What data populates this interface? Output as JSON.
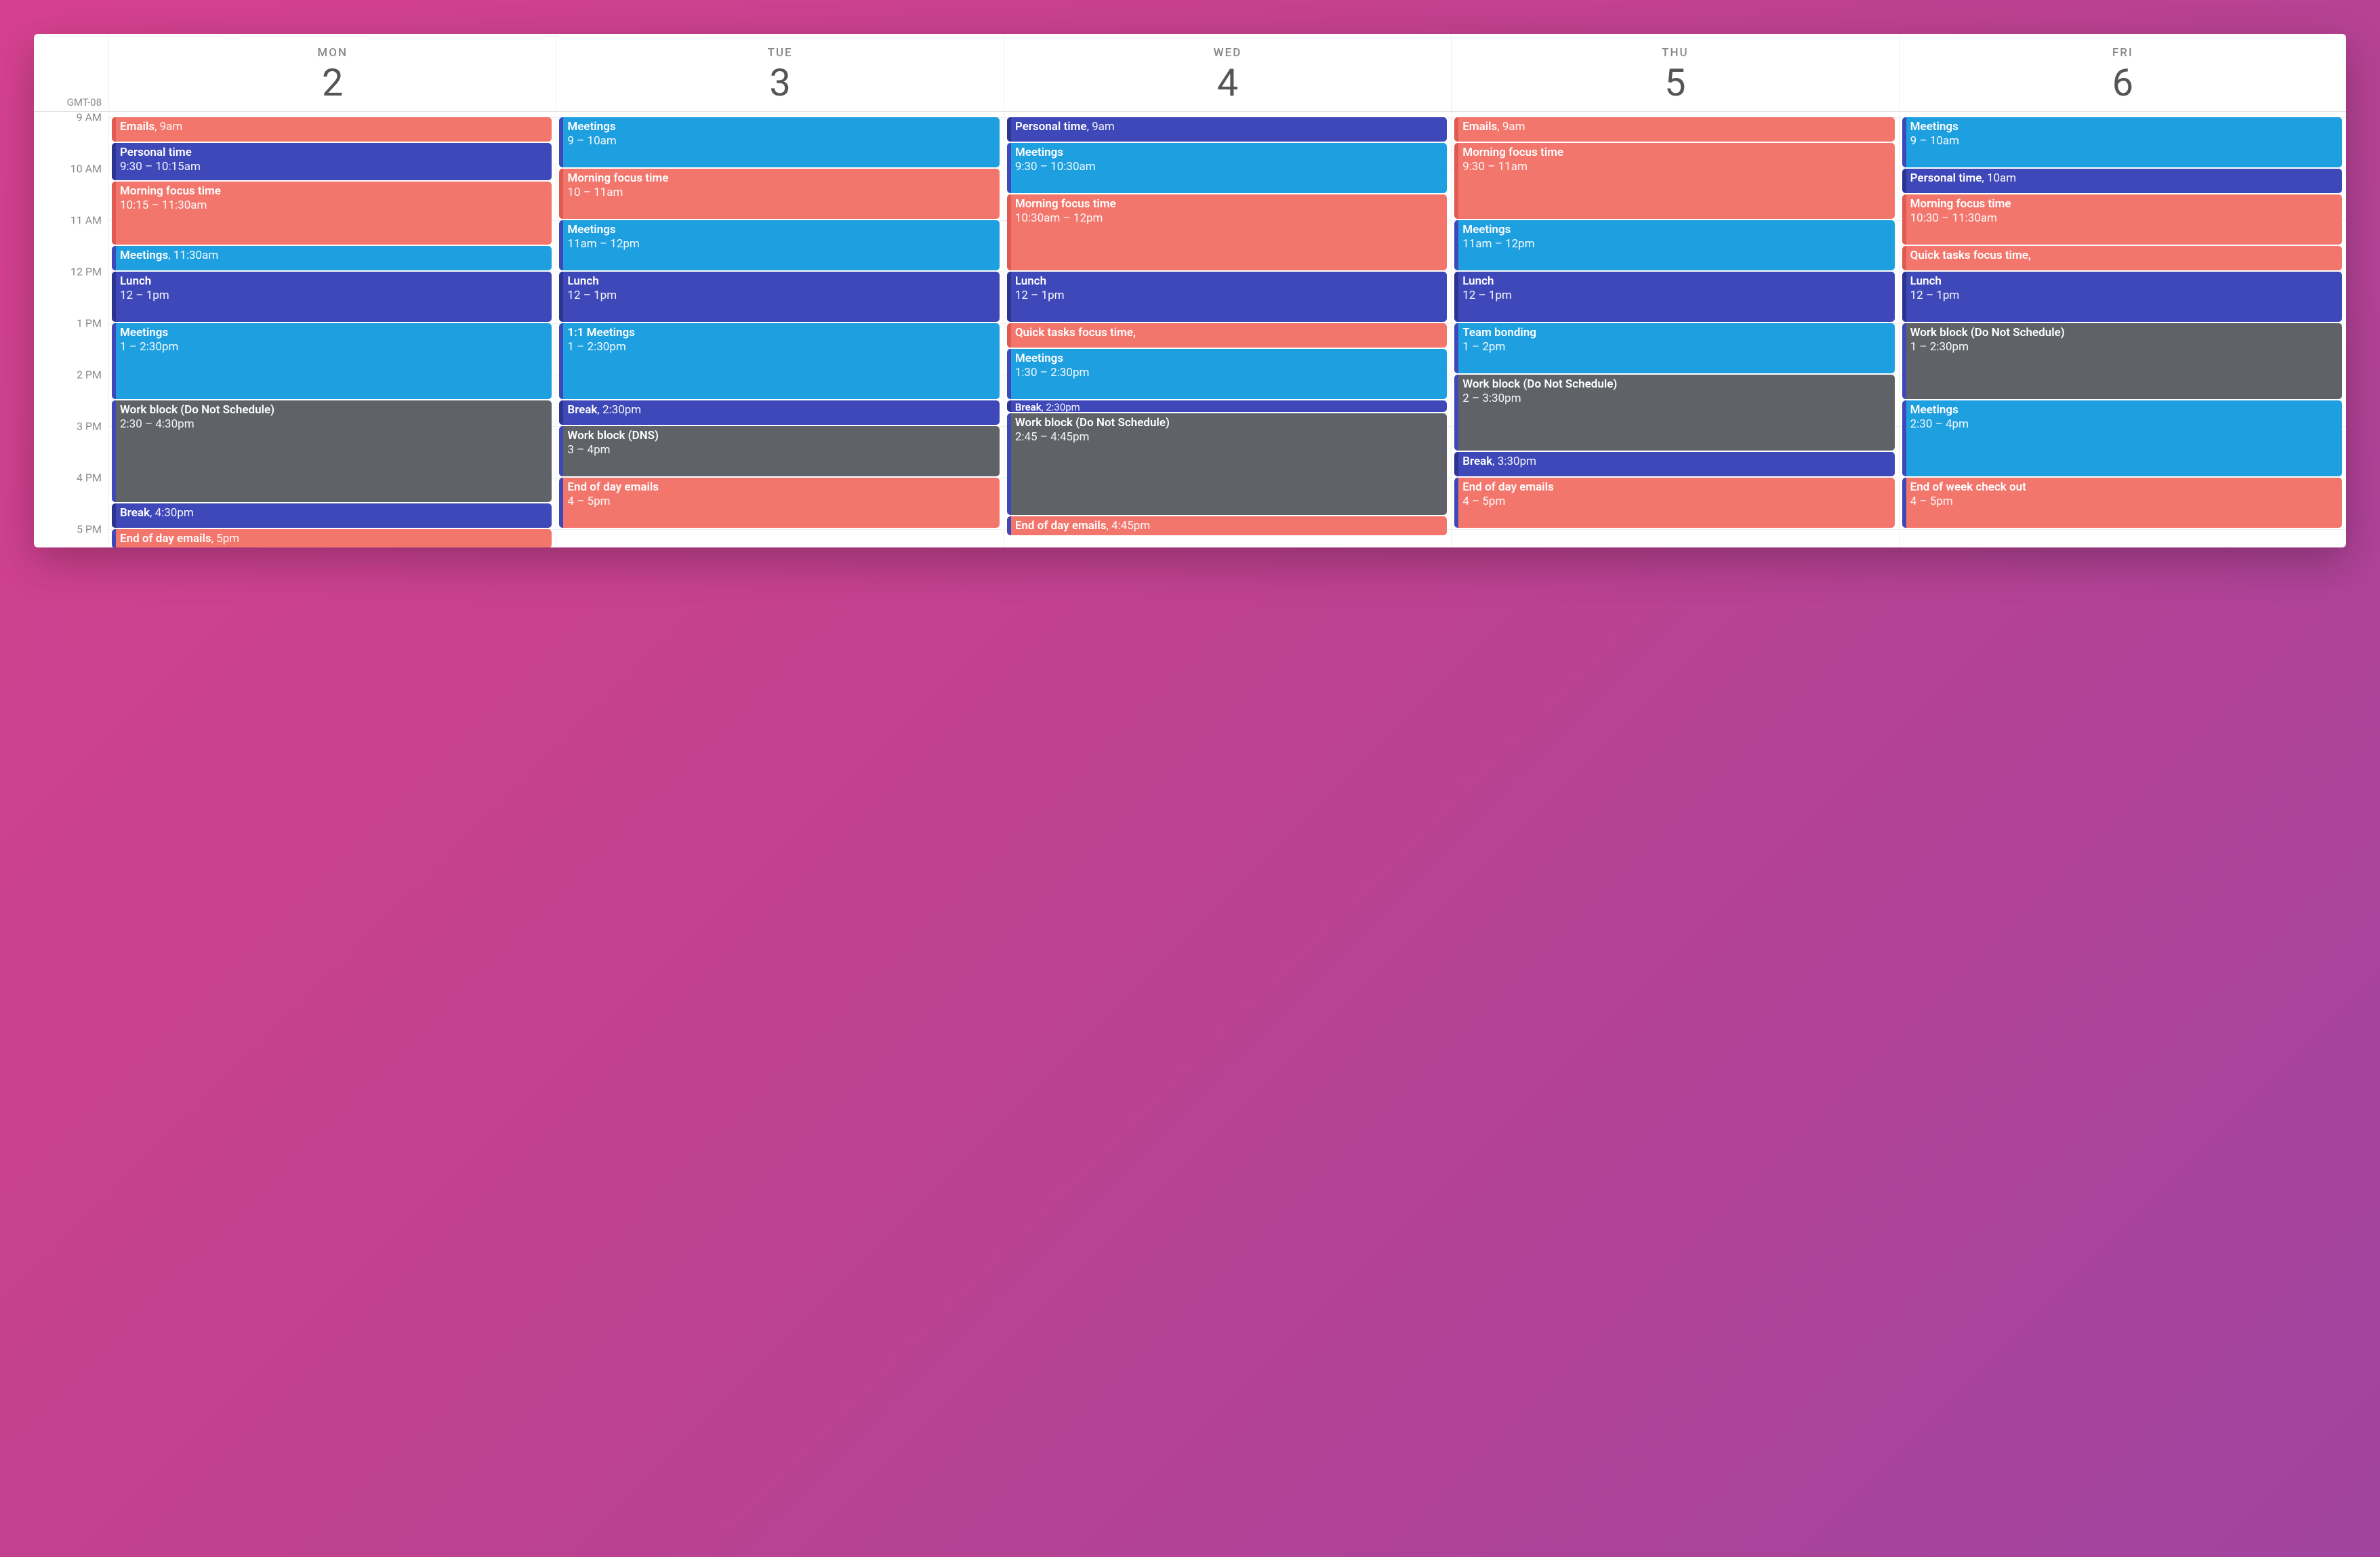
{
  "timezone": "GMT-08",
  "startHour": 9,
  "endHour": 17.25,
  "hourHeight": 76,
  "hours": [
    {
      "h": 9,
      "label": "9 AM"
    },
    {
      "h": 10,
      "label": "10 AM"
    },
    {
      "h": 11,
      "label": "11 AM"
    },
    {
      "h": 12,
      "label": "12 PM"
    },
    {
      "h": 13,
      "label": "1 PM"
    },
    {
      "h": 14,
      "label": "2 PM"
    },
    {
      "h": 15,
      "label": "3 PM"
    },
    {
      "h": 16,
      "label": "4 PM"
    },
    {
      "h": 17,
      "label": "5 PM"
    }
  ],
  "days": [
    {
      "abbr": "MON",
      "num": "2",
      "events": [
        {
          "title": "Emails",
          "time": "9am",
          "start": 9,
          "end": 9.5,
          "color": "c-pink",
          "short": true
        },
        {
          "title": "Personal time",
          "time": "9:30 – 10:15am",
          "start": 9.5,
          "end": 10.25,
          "color": "c-indigo"
        },
        {
          "title": "Morning focus time",
          "time": "10:15 – 11:30am",
          "start": 10.25,
          "end": 11.5,
          "color": "c-pink"
        },
        {
          "title": "Meetings",
          "time": "11:30am",
          "start": 11.5,
          "end": 12,
          "color": "c-sky",
          "short": true
        },
        {
          "title": "Lunch",
          "time": "12 – 1pm",
          "start": 12,
          "end": 13,
          "color": "c-indigo"
        },
        {
          "title": "Meetings",
          "time": "1 – 2:30pm",
          "start": 13,
          "end": 14.5,
          "color": "c-sky"
        },
        {
          "title": "Work block (Do Not Schedule)",
          "time": "2:30 – 4:30pm",
          "start": 14.5,
          "end": 16.5,
          "color": "c-gray"
        },
        {
          "title": "Break",
          "time": "4:30pm",
          "start": 16.5,
          "end": 17,
          "color": "c-indigo",
          "short": true
        },
        {
          "title": "End of day emails",
          "time": "5pm",
          "start": 17,
          "end": 17.4,
          "color": "c-pink2",
          "short": true
        }
      ]
    },
    {
      "abbr": "TUE",
      "num": "3",
      "events": [
        {
          "title": "Meetings",
          "time": "9 – 10am",
          "start": 9,
          "end": 10,
          "color": "c-sky"
        },
        {
          "title": "Morning focus time",
          "time": "10 – 11am",
          "start": 10,
          "end": 11,
          "color": "c-pink"
        },
        {
          "title": "Meetings",
          "time": "11am – 12pm",
          "start": 11,
          "end": 12,
          "color": "c-sky"
        },
        {
          "title": "Lunch",
          "time": "12 – 1pm",
          "start": 12,
          "end": 13,
          "color": "c-indigo"
        },
        {
          "title": "1:1 Meetings",
          "time": "1 – 2:30pm",
          "start": 13,
          "end": 14.5,
          "color": "c-sky"
        },
        {
          "title": "Break",
          "time": "2:30pm",
          "start": 14.5,
          "end": 15,
          "color": "c-indigo",
          "short": true
        },
        {
          "title": "Work block (DNS)",
          "time": "3 – 4pm",
          "start": 15,
          "end": 16,
          "color": "c-gray"
        },
        {
          "title": "End of day emails",
          "time": "4 – 5pm",
          "start": 16,
          "end": 17,
          "color": "c-pink2"
        }
      ]
    },
    {
      "abbr": "WED",
      "num": "4",
      "events": [
        {
          "title": "Personal time",
          "time": "9am",
          "start": 9,
          "end": 9.5,
          "color": "c-indigo",
          "short": true
        },
        {
          "title": "Meetings",
          "time": "9:30 – 10:30am",
          "start": 9.5,
          "end": 10.5,
          "color": "c-sky"
        },
        {
          "title": "Morning focus time",
          "time": "10:30am – 12pm",
          "start": 10.5,
          "end": 12,
          "color": "c-pink"
        },
        {
          "title": "Lunch",
          "time": "12 – 1pm",
          "start": 12,
          "end": 13,
          "color": "c-indigo"
        },
        {
          "title": "Quick tasks focus time,",
          "time": "",
          "start": 13,
          "end": 13.5,
          "color": "c-pink",
          "short": true
        },
        {
          "title": "Meetings",
          "time": "1:30 – 2:30pm",
          "start": 13.5,
          "end": 14.5,
          "color": "c-sky"
        },
        {
          "title": "Break",
          "time": "2:30pm",
          "start": 14.5,
          "end": 14.75,
          "color": "c-indigo",
          "short": true,
          "small": true
        },
        {
          "title": "Work block (Do Not Schedule)",
          "time": "2:45 – 4:45pm",
          "start": 14.75,
          "end": 16.75,
          "color": "c-gray"
        },
        {
          "title": "End of day emails",
          "time": "4:45pm",
          "start": 16.75,
          "end": 17.15,
          "color": "c-pink2",
          "short": true
        }
      ]
    },
    {
      "abbr": "THU",
      "num": "5",
      "events": [
        {
          "title": "Emails",
          "time": "9am",
          "start": 9,
          "end": 9.5,
          "color": "c-pink",
          "short": true
        },
        {
          "title": "Morning focus time",
          "time": "9:30 – 11am",
          "start": 9.5,
          "end": 11,
          "color": "c-pink"
        },
        {
          "title": "Meetings",
          "time": "11am – 12pm",
          "start": 11,
          "end": 12,
          "color": "c-sky"
        },
        {
          "title": "Lunch",
          "time": "12 – 1pm",
          "start": 12,
          "end": 13,
          "color": "c-indigo"
        },
        {
          "title": "Team bonding",
          "time": "1 – 2pm",
          "start": 13,
          "end": 14,
          "color": "c-sky"
        },
        {
          "title": "Work block (Do Not Schedule)",
          "time": "2 – 3:30pm",
          "start": 14,
          "end": 15.5,
          "color": "c-gray"
        },
        {
          "title": "Break",
          "time": "3:30pm",
          "start": 15.5,
          "end": 16,
          "color": "c-indigo",
          "short": true
        },
        {
          "title": "End of day emails",
          "time": "4 – 5pm",
          "start": 16,
          "end": 17,
          "color": "c-pink2"
        }
      ]
    },
    {
      "abbr": "FRI",
      "num": "6",
      "events": [
        {
          "title": "Meetings",
          "time": "9 – 10am",
          "start": 9,
          "end": 10,
          "color": "c-sky"
        },
        {
          "title": "Personal time",
          "time": "10am",
          "start": 10,
          "end": 10.5,
          "color": "c-indigo",
          "short": true
        },
        {
          "title": "Morning focus time",
          "time": "10:30 – 11:30am",
          "start": 10.5,
          "end": 11.5,
          "color": "c-pink"
        },
        {
          "title": "Quick tasks focus time,",
          "time": "",
          "start": 11.5,
          "end": 12,
          "color": "c-pink",
          "short": true
        },
        {
          "title": "Lunch",
          "time": "12 – 1pm",
          "start": 12,
          "end": 13,
          "color": "c-indigo"
        },
        {
          "title": "Work block (Do Not Schedule)",
          "time": "1 – 2:30pm",
          "start": 13,
          "end": 14.5,
          "color": "c-gray"
        },
        {
          "title": "Meetings",
          "time": "2:30 – 4pm",
          "start": 14.5,
          "end": 16,
          "color": "c-sky"
        },
        {
          "title": "End of week check out",
          "time": "4 – 5pm",
          "start": 16,
          "end": 17,
          "color": "c-pink2"
        }
      ]
    }
  ]
}
